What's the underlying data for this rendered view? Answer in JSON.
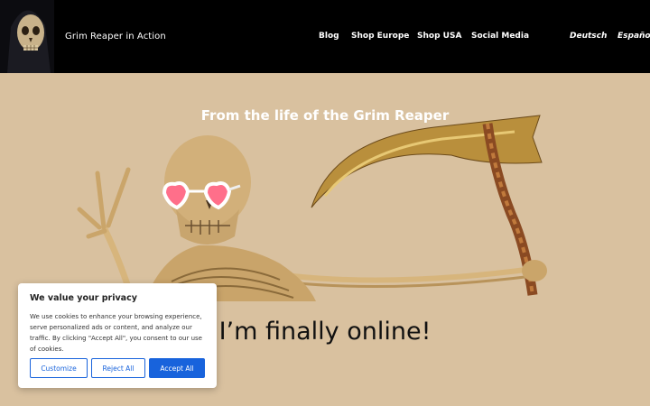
{
  "header": {
    "site_title": "Grim Reaper in Action",
    "nav": [
      {
        "label": "Blog"
      },
      {
        "label": "Shop Europe"
      },
      {
        "label": "Shop USA"
      },
      {
        "label": "Social Media"
      }
    ],
    "languages": [
      {
        "label": "Deutsch"
      },
      {
        "label": "Español"
      }
    ]
  },
  "hero": {
    "title": "From the life of the Grim Reaper",
    "headline": "I’m finally online!"
  },
  "cookie": {
    "title": "We value your privacy",
    "text": "We use cookies to enhance your browsing experience, serve personalized ads or content, and analyze our traffic. By clicking \"Accept All\", you consent to our use of cookies.",
    "customize": "Customize",
    "reject": "Reject All",
    "accept": "Accept All"
  },
  "colors": {
    "background": "#d9c19f",
    "header": "#000000",
    "accent_button": "#1863dc"
  }
}
